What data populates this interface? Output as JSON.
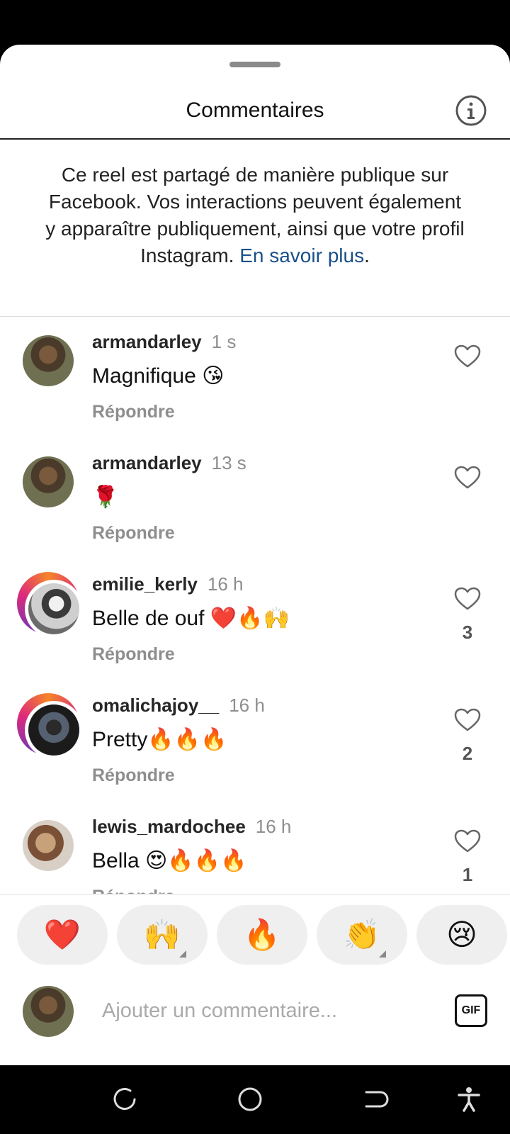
{
  "header": {
    "title": "Commentaires"
  },
  "notice": {
    "text": "Ce reel est partagé de manière publique sur Facebook. Vos interactions peuvent également y apparaître publiquement, ainsi que votre profil Instagram. ",
    "link": "En savoir plus",
    "end": "."
  },
  "comments": [
    {
      "username": "armandarley",
      "time": "1 s",
      "text": "Magnifique 😘",
      "reply": "Répondre",
      "likes": ""
    },
    {
      "username": "armandarley",
      "time": "13 s",
      "text": "🌹",
      "reply": "Répondre",
      "likes": ""
    },
    {
      "username": "emilie_kerly",
      "time": "16 h",
      "text": "Belle de ouf ❤️🔥🙌",
      "reply": "Répondre",
      "likes": "3"
    },
    {
      "username": "omalichajoy__",
      "time": "16 h",
      "text": "Pretty🔥🔥🔥",
      "reply": "Répondre",
      "likes": "2"
    },
    {
      "username": "lewis_mardochee",
      "time": "16 h",
      "text": "Bella 😍🔥🔥🔥",
      "reply": "Répondre",
      "likes": "1"
    }
  ],
  "reactions": [
    "❤️",
    "🙌",
    "🔥",
    "👏",
    "😢"
  ],
  "compose": {
    "placeholder": "Ajouter un commentaire...",
    "gif_label": "GIF"
  },
  "icons": [
    "info-icon",
    "heart-icon",
    "gif-icon",
    "recent-apps-icon",
    "home-icon",
    "back-icon",
    "accessibility-icon"
  ]
}
